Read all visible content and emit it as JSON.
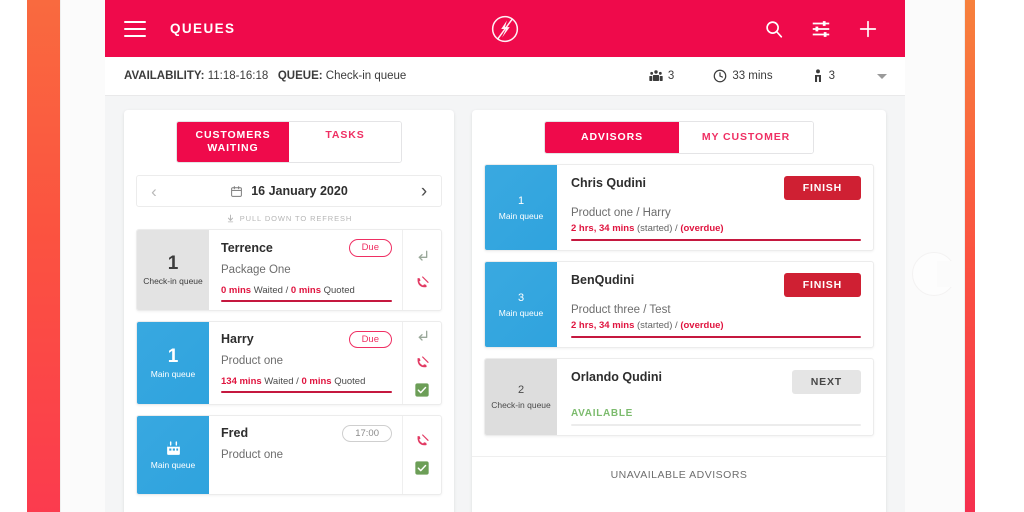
{
  "appbar": {
    "title": "QUEUES",
    "menu_icon": "hamburger-icon",
    "logo_icon": "qudini-logo-icon",
    "search_icon": "search-icon",
    "filter_icon": "filter-sliders-icon",
    "add_icon": "plus-icon",
    "brand_color": "#ef0a4b"
  },
  "availability": {
    "availability_label": "AVAILABILITY:",
    "availability_value": "11:18-16:18",
    "queue_label": "QUEUE:",
    "queue_value": "Check-in queue",
    "stats": [
      {
        "icon": "group-people-icon",
        "value": "3"
      },
      {
        "icon": "clock-icon",
        "value": "33 mins"
      },
      {
        "icon": "person-standing-icon",
        "value": "3"
      }
    ],
    "dropdown_icon": "chevron-down-icon"
  },
  "left_panel": {
    "tabs": [
      {
        "label": "CUSTOMERS WAITING",
        "active": true
      },
      {
        "label": "TASKS",
        "active": false
      }
    ],
    "date_nav": {
      "prev_icon": "chevron-left-icon",
      "next_icon": "chevron-right-icon",
      "calendar_icon": "calendar-icon",
      "date": "16 January 2020"
    },
    "refresh_hint": {
      "icon": "download-arrow-icon",
      "text": "PULL DOWN TO REFRESH"
    },
    "customers": [
      {
        "queue_number": "1",
        "queue_name": "Check-in queue",
        "badge_style": "grey",
        "name": "Terrence",
        "product": "Package One",
        "pill": "Due",
        "pill_style": "due",
        "meta_waited": "0 mins",
        "meta_waited_suffix": " Waited / ",
        "meta_quoted": "0 mins",
        "meta_quoted_suffix": " Quoted",
        "progress": 96,
        "actions": [
          "return-arrow-icon",
          "phone-missed-icon"
        ]
      },
      {
        "queue_number": "1",
        "queue_name": "Main queue",
        "badge_style": "blue",
        "name": "Harry",
        "product": "Product one",
        "pill": "Due",
        "pill_style": "due",
        "meta_waited": "134 mins",
        "meta_waited_suffix": " Waited / ",
        "meta_quoted": "0 mins",
        "meta_quoted_suffix": " Quoted",
        "progress": 100,
        "actions": [
          "return-arrow-icon",
          "phone-missed-icon",
          "check-square-icon"
        ]
      },
      {
        "queue_number": "",
        "queue_name": "Main queue",
        "badge_style": "blue",
        "badge_icon": "calendar-icon",
        "name": "Fred",
        "product": "Product one",
        "pill": "17:00",
        "pill_style": "time",
        "actions": [
          "phone-missed-icon",
          "check-square-icon"
        ]
      }
    ]
  },
  "right_panel": {
    "tabs": [
      {
        "label": "ADVISORS",
        "active": true
      },
      {
        "label": "MY CUSTOMER",
        "active": false
      }
    ],
    "advisors": [
      {
        "queue_number": "1",
        "queue_name": "Main queue",
        "badge_style": "blue",
        "name": "Chris Qudini",
        "detail": "Product one / Harry",
        "meta_time": "2 hrs, 34 mins",
        "meta_started": " (started) / ",
        "meta_overdue": "(overdue)",
        "button": "FINISH",
        "button_style": "finish",
        "progress_style": "red"
      },
      {
        "queue_number": "3",
        "queue_name": "Main queue",
        "badge_style": "blue",
        "name": "BenQudini",
        "detail": "Product three / Test",
        "meta_time": "2 hrs, 34 mins",
        "meta_started": " (started) / ",
        "meta_overdue": "(overdue)",
        "button": "FINISH",
        "button_style": "finish",
        "progress_style": "red"
      },
      {
        "queue_number": "2",
        "queue_name": "Check-in queue",
        "badge_style": "grey",
        "name": "Orlando Qudini",
        "status": "AVAILABLE",
        "button": "NEXT",
        "button_style": "next",
        "progress_style": "grey"
      }
    ],
    "unavailable_header": "UNAVAILABLE ADVISORS"
  }
}
